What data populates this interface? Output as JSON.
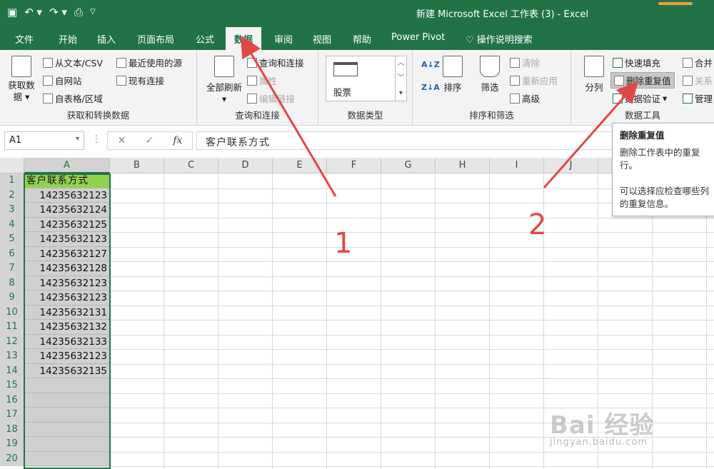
{
  "window": {
    "title": "新建 Microsoft Excel 工作表 (3)  -  Excel"
  },
  "tabs": [
    "文件",
    "开始",
    "插入",
    "页面布局",
    "公式",
    "数据",
    "审阅",
    "视图",
    "帮助",
    "Power Pivot",
    "操作说明搜索"
  ],
  "active_tab": "数据",
  "ribbon": {
    "get_data": {
      "big_label": "获取数据",
      "items": [
        "从文本/CSV",
        "自网站",
        "自表格/区域",
        "最近使用的源",
        "现有连接"
      ],
      "label": "获取和转换数据"
    },
    "queries": {
      "refresh_label": "全部刷新",
      "items": [
        "查询和连接",
        "属性",
        "编辑链接"
      ],
      "label": "查询和连接"
    },
    "data_types": {
      "stock": "股票",
      "label": "数据类型"
    },
    "sort_filter": {
      "sort": "排序",
      "filter": "筛选",
      "clear": "清除",
      "reapply": "重新应用",
      "advanced": "高级",
      "label": "排序和筛选"
    },
    "data_tools": {
      "split": "分列",
      "flash_fill": "快速填充",
      "remove_dup": "删除重复值",
      "validation": "数据验证",
      "merge": "合并",
      "relations": "关系",
      "manage": "管理",
      "label": "数据工具"
    }
  },
  "formula_bar": {
    "name_box": "A1",
    "fx": "fx",
    "content": "客户联系方式"
  },
  "columns": [
    "A",
    "B",
    "C",
    "D",
    "E",
    "F",
    "G",
    "H",
    "I",
    "J"
  ],
  "rows": [
    "1",
    "2",
    "3",
    "4",
    "5",
    "6",
    "7",
    "8",
    "9",
    "10",
    "11",
    "12",
    "13",
    "14",
    "15",
    "16",
    "17",
    "18",
    "19",
    "20"
  ],
  "cells_A": [
    "客户联系方式",
    "14235632123",
    "14235632124",
    "14235632125",
    "14235632123",
    "14235632127",
    "14235632128",
    "14235632123",
    "14235632123",
    "14235632131",
    "14235632132",
    "14235632133",
    "14235632123",
    "14235632135",
    "",
    "",
    "",
    "",
    "",
    ""
  ],
  "tooltip": {
    "title": "删除重复值",
    "desc1": "删除工作表中的重复行。",
    "desc2": "可以选择应检查哪些列的重复信息。"
  },
  "annotations": [
    "1",
    "2"
  ],
  "watermark": {
    "main": "Bai 经验",
    "sub": "jingyan.baidu.com"
  },
  "colors": {
    "excel_green": "#217346",
    "header_fill": "#92d050",
    "annotation": "#e04848"
  }
}
